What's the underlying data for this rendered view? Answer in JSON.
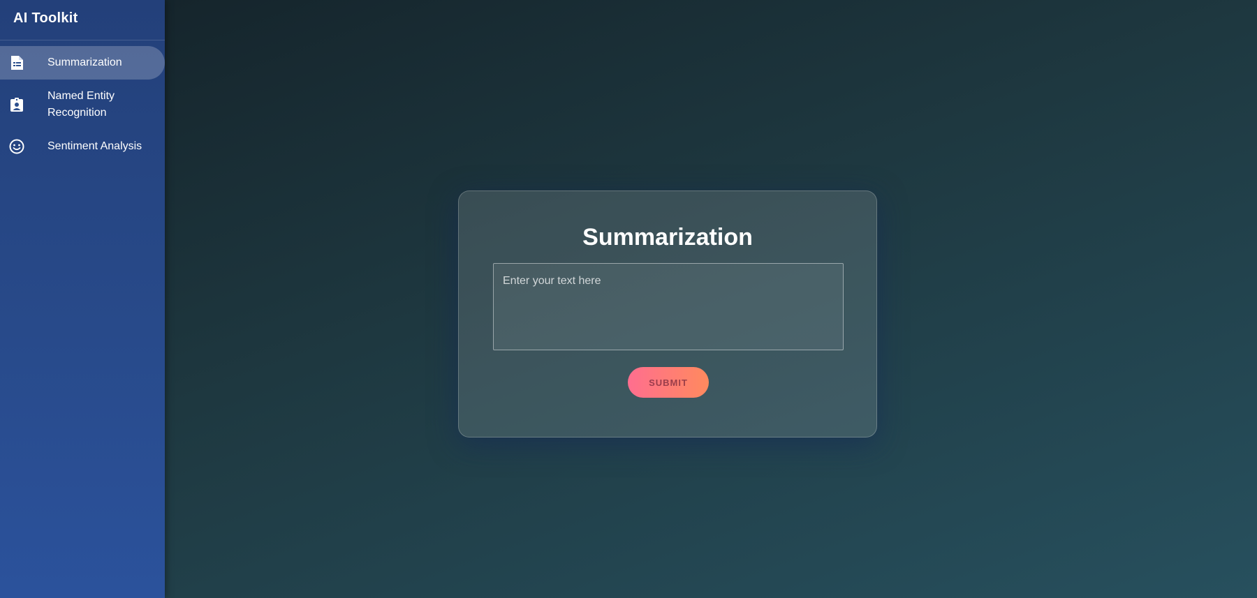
{
  "sidebar": {
    "title": "AI Toolkit",
    "items": [
      {
        "label": "Summarization",
        "icon": "summarize-document-icon",
        "active": true
      },
      {
        "label": "Named Entity Recognition",
        "icon": "assignment-ind-icon",
        "active": false
      },
      {
        "label": "Sentiment Analysis",
        "icon": "smiley-face-icon",
        "active": false
      }
    ]
  },
  "main": {
    "card": {
      "title": "Summarization",
      "input_placeholder": "Enter your text here",
      "input_value": "",
      "submit_label": "SUBMIT"
    }
  },
  "colors": {
    "sidebar_top": "#23407a",
    "sidebar_bottom": "#2b529c",
    "background_dark": "#142229",
    "background_light": "#27505e",
    "button_gradient_start": "#ff6e8f",
    "button_gradient_end": "#ff8a5e"
  }
}
